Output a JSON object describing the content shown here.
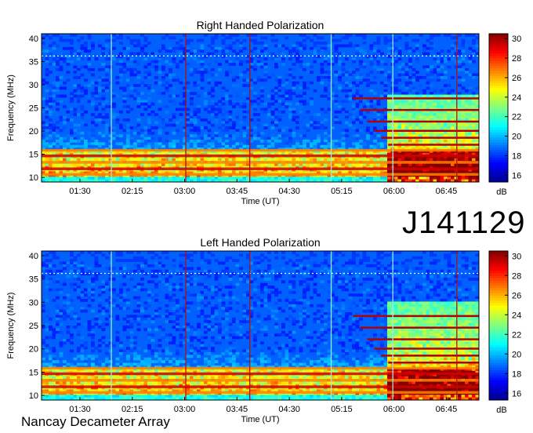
{
  "observation_id": "J141129",
  "instrument": "Nancay Decameter Array",
  "colors": {
    "colormap": [
      "#00008f",
      "#0000ff",
      "#0080ff",
      "#00ffff",
      "#80ff80",
      "#ffff00",
      "#ff8000",
      "#ff0000",
      "#800000"
    ],
    "cursor_cyan": "#9fe8e0",
    "cursor_red": "#b01010"
  },
  "chart_data": [
    {
      "type": "heatmap",
      "title": "Right Handed Polarization",
      "xlabel": "Time (UT)",
      "ylabel": "Frequency (MHz)",
      "x_ticks": [
        "01:30",
        "02:15",
        "03:00",
        "03:45",
        "04:30",
        "05:15",
        "06:00",
        "06:45"
      ],
      "x_tick_minutes": [
        90,
        135,
        180,
        225,
        270,
        315,
        360,
        405
      ],
      "xlim_minutes": [
        57,
        433
      ],
      "ylim": [
        9,
        41
      ],
      "y_ticks": [
        10,
        15,
        20,
        25,
        30,
        35,
        40
      ],
      "colorbar": {
        "label": "dB",
        "range": [
          15.3,
          30.5
        ],
        "ticks": [
          16,
          18,
          20,
          22,
          24,
          26,
          28,
          30
        ]
      },
      "time_markers_minutes": [
        {
          "t": 117,
          "c": "cyan"
        },
        {
          "t": 181,
          "c": "red"
        },
        {
          "t": 236,
          "c": "red"
        },
        {
          "t": 306,
          "c": "cyan"
        },
        {
          "t": 359,
          "c": "cyan"
        },
        {
          "t": 414,
          "c": "red"
        }
      ],
      "interference_line_mhz": 36.2,
      "emission": {
        "low_freq_band_mhz": [
          10,
          16
        ],
        "late_emission_start_minutes": 355,
        "late_emission_top_mhz": 28
      }
    },
    {
      "type": "heatmap",
      "title": "Left Handed Polarization",
      "xlabel": "Time (UT)",
      "ylabel": "Frequency (MHz)",
      "x_ticks": [
        "01:30",
        "02:15",
        "03:00",
        "03:45",
        "04:30",
        "05:15",
        "06:00",
        "06:45"
      ],
      "x_tick_minutes": [
        90,
        135,
        180,
        225,
        270,
        315,
        360,
        405
      ],
      "xlim_minutes": [
        57,
        433
      ],
      "ylim": [
        9,
        41
      ],
      "y_ticks": [
        10,
        15,
        20,
        25,
        30,
        35,
        40
      ],
      "colorbar": {
        "label": "dB",
        "range": [
          15.3,
          30.5
        ],
        "ticks": [
          16,
          18,
          20,
          22,
          24,
          26,
          28,
          30
        ]
      },
      "time_markers_minutes": [
        {
          "t": 117,
          "c": "cyan"
        },
        {
          "t": 181,
          "c": "red"
        },
        {
          "t": 236,
          "c": "red"
        },
        {
          "t": 306,
          "c": "cyan"
        },
        {
          "t": 359,
          "c": "cyan"
        },
        {
          "t": 414,
          "c": "red"
        }
      ],
      "interference_line_mhz": 36.2,
      "emission": {
        "low_freq_band_mhz": [
          10,
          16
        ],
        "late_emission_start_minutes": 355,
        "late_emission_top_mhz": 30
      }
    }
  ]
}
